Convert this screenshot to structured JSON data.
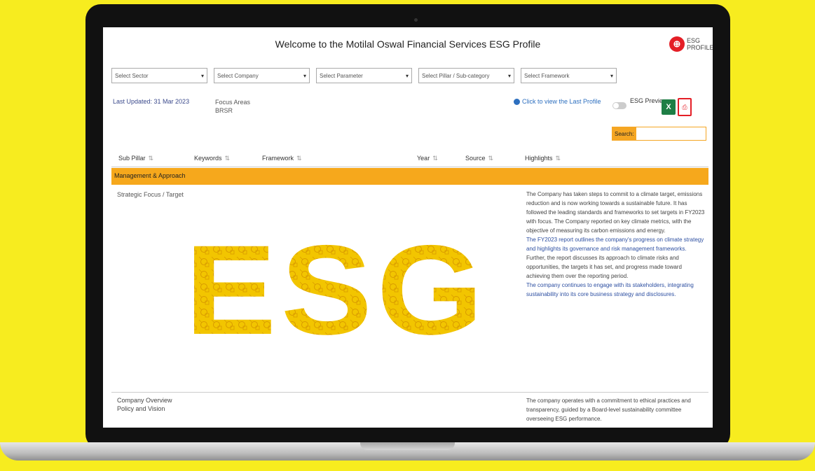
{
  "window": {
    "title": "Welcome to the Motilal Oswal Financial Services ESG Profile"
  },
  "brand": {
    "logo_mark": "⊕",
    "logo_text": "ESG PROFILE",
    "accent_color": "#f6a81c",
    "background_color": "#f7ec1f",
    "esg_graphic_text": "ESG",
    "esg_graphic_color": "#f2c500"
  },
  "filters": [
    {
      "label": "Select Sector"
    },
    {
      "label": "Select Company"
    },
    {
      "label": "Select Parameter"
    },
    {
      "label": "Select Pillar / Sub-category"
    },
    {
      "label": "Select Framework"
    }
  ],
  "info": {
    "last_updated": "Last Updated: 31 Mar 2023",
    "focus_label": "Focus Areas",
    "focus_value": "BRSR",
    "reference_link": "Click to view the Last Profile",
    "esg_preview": "ESG Preview"
  },
  "icons": {
    "excel": "excel-icon",
    "pdf": "pdf-icon",
    "ref": "info-circle-icon"
  },
  "search": {
    "label": "Search:",
    "placeholder": ""
  },
  "table": {
    "headers": [
      "Sub Pillar",
      "Keywords",
      "Framework",
      "Year",
      "Source",
      "Highlights"
    ],
    "section": "Management & Approach",
    "row1": {
      "name": "Strategic Focus / Target",
      "highlights_1": "The Company has taken steps to commit to a climate target, emissions reduction and is now working towards a sustainable future. It has followed the leading standards and frameworks to set targets in FY2023 with focus. The Company reported on key climate metrics, with the objective of measuring its carbon emissions and energy.",
      "highlights_2": "The FY2023 report outlines the company's progress on climate strategy and highlights its governance and risk management frameworks.",
      "highlights_3": "Further, the report discusses its approach to climate risks and opportunities, the targets it has set, and progress made toward achieving them over the reporting period.",
      "highlights_4": "The company continues to engage with its stakeholders, integrating sustainability into its core business strategy and disclosures."
    },
    "row2": {
      "name": "Company Overview",
      "sub": "Policy and Vision",
      "highlights": "The company operates with a commitment to ethical practices and transparency, guided by a Board-level sustainability committee overseeing ESG performance."
    }
  }
}
